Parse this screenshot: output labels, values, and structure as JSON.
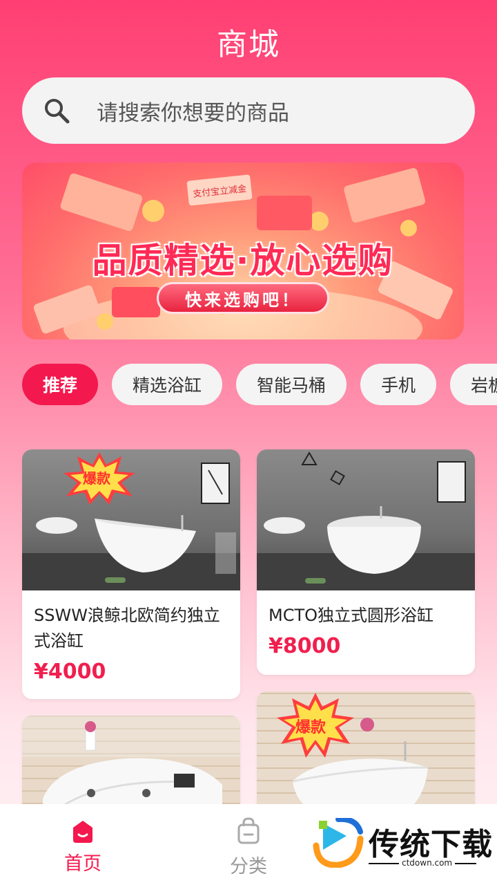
{
  "header": {
    "title": "商城"
  },
  "search": {
    "placeholder": "请搜索你想要的商品"
  },
  "banner": {
    "headline": "品质精选·放心选购",
    "cta": "快来选购吧！",
    "pay_label": "支付宝立减金"
  },
  "tabs": [
    {
      "label": "推荐",
      "active": true
    },
    {
      "label": "精选浴缸",
      "active": false
    },
    {
      "label": "智能马桶",
      "active": false
    },
    {
      "label": "手机",
      "active": false
    },
    {
      "label": "岩板",
      "active": false
    }
  ],
  "products": [
    {
      "name": "SSWW浪鲸北欧简约独立式浴缸",
      "price": "¥4000",
      "badge": "爆款"
    },
    {
      "name": "MCTO独立式圆形浴缸",
      "price": "¥8000",
      "badge": ""
    },
    {
      "name": "",
      "price": "",
      "badge": ""
    },
    {
      "name": "",
      "price": "",
      "badge": "爆款"
    }
  ],
  "bottom_nav": {
    "home": "首页",
    "category": "分类"
  },
  "watermark": {
    "brand": "传统下载",
    "url": "ctdown.com"
  },
  "colors": {
    "accent": "#f3184d",
    "price": "#f01f4e"
  }
}
